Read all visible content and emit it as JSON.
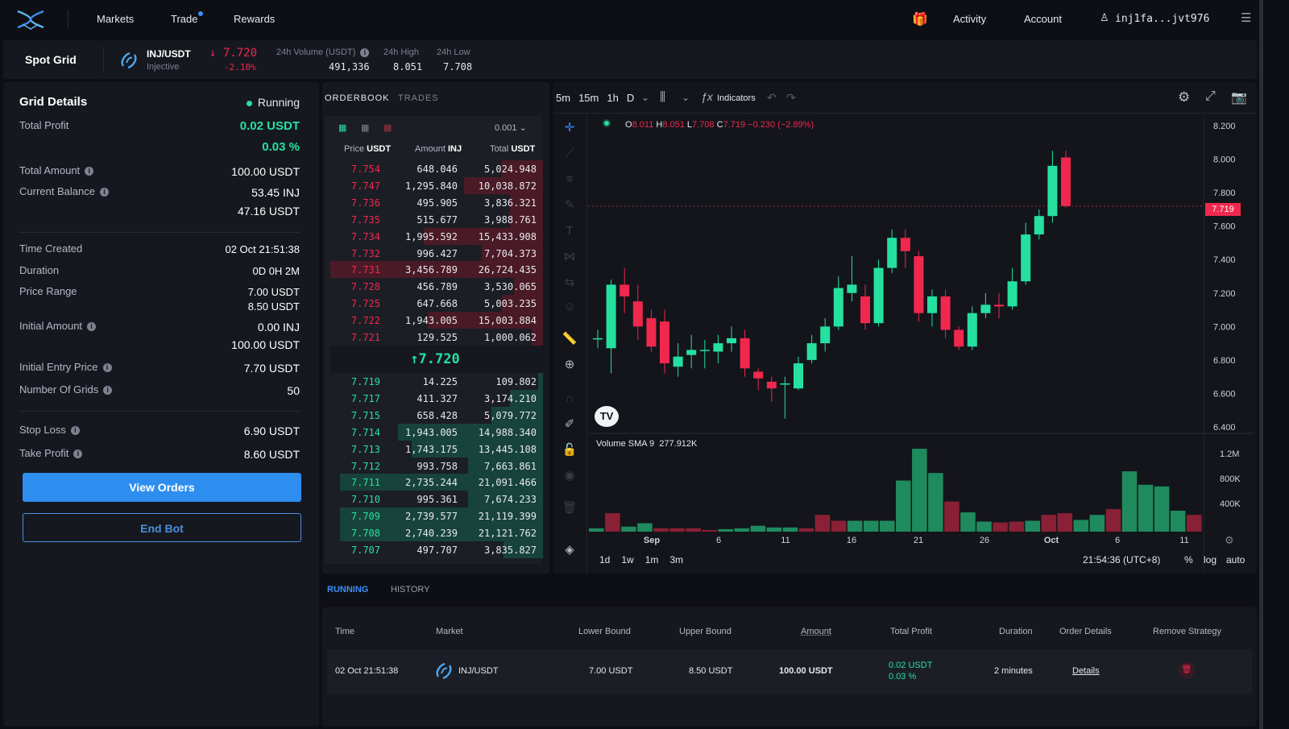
{
  "nav": {
    "markets": "Markets",
    "trade": "Trade",
    "rewards": "Rewards",
    "activity": "Activity",
    "account": "Account",
    "wallet": "inj1fa...jvt976"
  },
  "sub": {
    "title": "Spot Grid",
    "pair": "INJ/USDT",
    "pair_name": "Injective",
    "price": "↓ 7.720",
    "change": "-2.10%",
    "vol_label": "24h Volume (USDT)",
    "vol": "491,336",
    "high_label": "24h High",
    "high": "8.051",
    "low_label": "24h Low",
    "low": "7.708"
  },
  "grid": {
    "title": "Grid Details",
    "status": "Running",
    "total_profit_label": "Total Profit",
    "total_profit": "0.02 USDT",
    "total_profit_pct": "0.03 %",
    "total_amount_label": "Total Amount",
    "total_amount": "100.00 USDT",
    "balance_label": "Current Balance",
    "balance_inj": "53.45 INJ",
    "balance_usdt": "47.16 USDT",
    "time_created_label": "Time Created",
    "time_created": "02 Oct 21:51:38",
    "duration_label": "Duration",
    "duration": "0D 0H 2M",
    "price_range_label": "Price Range",
    "price_range_low": "7.00 USDT",
    "price_range_high": "8.50 USDT",
    "initial_amount_label": "Initial Amount",
    "initial_inj": "0.00 INJ",
    "initial_usdt": "100.00 USDT",
    "entry_label": "Initial Entry Price",
    "entry": "7.70 USDT",
    "grids_label": "Number Of Grids",
    "grids": "50",
    "stop_loss_label": "Stop Loss",
    "stop_loss": "6.90 USDT",
    "take_profit_label": "Take Profit",
    "take_profit": "8.60 USDT",
    "view_orders": "View Orders",
    "end_bot": "End Bot"
  },
  "orderbook": {
    "tab_orderbook": "ORDERBOOK",
    "tab_trades": "TRADES",
    "precision": "0.001",
    "h_price": "Price",
    "h_amount": "Amount",
    "h_total": "Total",
    "u_usdt": "USDT",
    "u_inj": "INJ",
    "u_usdt2": "USDT",
    "mid": "↑7.720",
    "asks": [
      [
        "7.754",
        "648.046",
        "5,024.948",
        0.19
      ],
      [
        "7.747",
        "1,295.840",
        "10,038.872",
        0.38
      ],
      [
        "7.736",
        "495.905",
        "3,836.321",
        0.15
      ],
      [
        "7.735",
        "515.677",
        "3,988.761",
        0.15
      ],
      [
        "7.734",
        "1,995.592",
        "15,433.908",
        0.58
      ],
      [
        "7.732",
        "996.427",
        "7,704.373",
        0.29
      ],
      [
        "7.731",
        "3,456.789",
        "26,724.435",
        1.0
      ],
      [
        "7.728",
        "456.789",
        "3,530.065",
        0.13
      ],
      [
        "7.725",
        "647.668",
        "5,003.235",
        0.19
      ],
      [
        "7.722",
        "1,943.005",
        "15,003.884",
        0.56
      ],
      [
        "7.721",
        "129.525",
        "1,000.062",
        0.04
      ]
    ],
    "bids": [
      [
        "7.719",
        "14.225",
        "109.802",
        0.01
      ],
      [
        "7.717",
        "411.327",
        "3,174.210",
        0.15
      ],
      [
        "7.715",
        "658.428",
        "5,079.772",
        0.24
      ],
      [
        "7.714",
        "1,943.005",
        "14,988.340",
        0.71
      ],
      [
        "7.713",
        "1,743.175",
        "13,445.108",
        0.64
      ],
      [
        "7.712",
        "993.758",
        "7,663.861",
        0.36
      ],
      [
        "7.711",
        "2,735.244",
        "21,091.466",
        1.0
      ],
      [
        "7.710",
        "995.361",
        "7,674.233",
        0.36
      ],
      [
        "7.709",
        "2,739.577",
        "21,119.399",
        1.0
      ],
      [
        "7.708",
        "2,740.239",
        "21,121.762",
        1.0
      ],
      [
        "7.707",
        "497.707",
        "3,835.827",
        0.18
      ]
    ]
  },
  "chart": {
    "intervals": [
      "5m",
      "15m",
      "1h",
      "D"
    ],
    "indicators": "Indicators",
    "ohlc_o_label": "O",
    "ohlc_o": "8.011",
    "ohlc_h_label": "H",
    "ohlc_h": "8.051",
    "ohlc_l_label": "L",
    "ohlc_l": "7.708",
    "ohlc_c_label": "C",
    "ohlc_c": "7.719",
    "ohlc_chg": "−0.230 (−2.89%)",
    "volume_label": "Volume SMA 9",
    "volume_val": "277.912K",
    "last_price": "7.719",
    "time_ranges": [
      "1d",
      "1w",
      "1m",
      "3m"
    ],
    "clock": "21:54:36 (UTC+8)",
    "pct": "%",
    "log": "log",
    "auto": "auto",
    "up_color": "#26e0a0",
    "down_color": "#f0284e"
  },
  "chart_data": {
    "type": "candlestick",
    "y_ticks": [
      "8.200",
      "8.000",
      "7.800",
      "7.600",
      "7.400",
      "7.200",
      "7.000",
      "6.800",
      "6.600",
      "6.400"
    ],
    "x_ticks": [
      "Sep",
      "6",
      "11",
      "16",
      "21",
      "26",
      "Oct",
      "6",
      "11"
    ],
    "vol_ticks": [
      "1.2M",
      "800K",
      "400K"
    ],
    "ylim": [
      6.4,
      8.2
    ],
    "candles": [
      [
        6.93,
        6.93,
        6.87,
        6.98
      ],
      [
        6.87,
        7.25,
        6.72,
        7.28
      ],
      [
        7.25,
        7.18,
        7.08,
        7.35
      ],
      [
        7.15,
        7.0,
        6.92,
        7.25
      ],
      [
        7.05,
        6.88,
        6.85,
        7.1
      ],
      [
        7.03,
        6.78,
        6.72,
        7.1
      ],
      [
        6.76,
        6.82,
        6.7,
        6.9
      ],
      [
        6.83,
        6.86,
        6.75,
        6.95
      ],
      [
        6.86,
        6.86,
        6.75,
        6.92
      ],
      [
        6.85,
        6.9,
        6.78,
        6.95
      ],
      [
        6.9,
        6.93,
        6.85,
        7.0
      ],
      [
        6.93,
        6.75,
        6.7,
        6.98
      ],
      [
        6.73,
        6.69,
        6.62,
        6.75
      ],
      [
        6.67,
        6.63,
        6.55,
        6.7
      ],
      [
        6.66,
        6.66,
        6.45,
        6.7
      ],
      [
        6.63,
        6.78,
        6.62,
        6.82
      ],
      [
        6.8,
        6.9,
        6.78,
        6.95
      ],
      [
        6.9,
        7.0,
        6.85,
        7.05
      ],
      [
        7.0,
        7.23,
        6.98,
        7.3
      ],
      [
        7.2,
        7.25,
        7.15,
        7.42
      ],
      [
        7.18,
        7.02,
        6.98,
        7.25
      ],
      [
        7.02,
        7.35,
        7.0,
        7.4
      ],
      [
        7.35,
        7.53,
        7.32,
        7.58
      ],
      [
        7.53,
        7.45,
        7.35,
        7.58
      ],
      [
        7.42,
        7.08,
        7.03,
        7.45
      ],
      [
        7.08,
        7.18,
        7.0,
        7.22
      ],
      [
        7.18,
        6.98,
        6.93,
        7.22
      ],
      [
        6.98,
        6.88,
        6.86,
        7.0
      ],
      [
        6.88,
        7.08,
        6.86,
        7.12
      ],
      [
        7.08,
        7.13,
        7.05,
        7.2
      ],
      [
        7.13,
        7.12,
        7.05,
        7.2
      ],
      [
        7.12,
        7.27,
        7.1,
        7.35
      ],
      [
        7.27,
        7.55,
        7.25,
        7.62
      ],
      [
        7.55,
        7.66,
        7.52,
        7.7
      ],
      [
        7.66,
        7.96,
        7.62,
        8.05
      ],
      [
        8.01,
        7.72,
        7.71,
        8.05
      ]
    ],
    "volumes": [
      0.04,
      0.22,
      0.06,
      0.1,
      0.04,
      0.04,
      0.04,
      0.02,
      0.03,
      0.04,
      0.07,
      0.05,
      0.05,
      0.04,
      0.2,
      0.13,
      0.13,
      0.13,
      0.13,
      0.61,
      0.99,
      0.7,
      0.36,
      0.23,
      0.12,
      0.11,
      0.12,
      0.13,
      0.2,
      0.22,
      0.14,
      0.2,
      0.27,
      0.72,
      0.56,
      0.54,
      0.25,
      0.2
    ]
  },
  "bottom": {
    "tab_running": "RUNNING",
    "tab_history": "HISTORY",
    "headers": {
      "time": "Time",
      "market": "Market",
      "lower": "Lower Bound",
      "upper": "Upper Bound",
      "amount": "Amount",
      "profit": "Total Profit",
      "duration": "Duration",
      "details": "Order Details",
      "remove": "Remove Strategy"
    },
    "row": {
      "time": "02 Oct 21:51:38",
      "market": "INJ/USDT",
      "lower": "7.00 USDT",
      "upper": "8.50 USDT",
      "amount": "100.00 USDT",
      "profit": "0.02 USDT",
      "profit_pct": "0.03 %",
      "duration": "2 minutes",
      "details": "Details"
    }
  }
}
